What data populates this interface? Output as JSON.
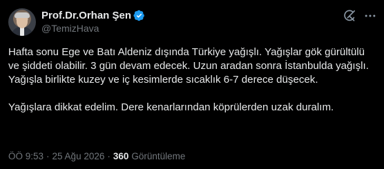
{
  "author": {
    "name": "Prof.Dr.Orhan Şen",
    "handle": "@TemizHava",
    "verified": true
  },
  "tweet": {
    "paragraphs": [
      "Hafta sonu Ege ve Batı Aldeniz dışında Türkiye yağışlı. Yağışlar gök gürültülü ve şiddeti olabilir. 3 gün devam edecek.  Uzun aradan sonra İstanbulda yağışlı. Yağışla birlikte kuzey ve iç kesimlerde sıcaklık 6-7 derece düşecek.",
      "Yağışlara dikkat edelim. Dere kenarlarından köprülerden uzak duralım."
    ]
  },
  "meta": {
    "time": "ÖÖ 9:53",
    "separator": "·",
    "date": "25 Ağu 2026",
    "views_count": "360",
    "views_label": "Görüntüleme"
  },
  "icons": {
    "verified": "verified-badge-icon",
    "grok": "grok-icon",
    "more": "more-options-icon"
  },
  "colors": {
    "background": "#000000",
    "text_primary": "#e7e9ea",
    "text_secondary": "#71767b",
    "verified_blue": "#1d9bf0"
  }
}
